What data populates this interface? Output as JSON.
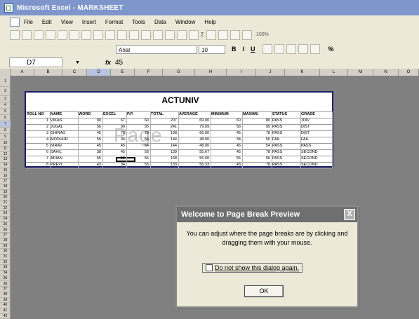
{
  "window": {
    "title": "Microsoft Excel - MARKSHEET"
  },
  "menu": [
    "File",
    "Edit",
    "View",
    "Insert",
    "Format",
    "Tools",
    "Data",
    "Window",
    "Help"
  ],
  "formatting": {
    "font": "Arial",
    "size": "10",
    "bold": "B",
    "italic": "I",
    "underline": "U",
    "percent": "%",
    "zoom": "100%"
  },
  "formula_bar": {
    "cell": "D7",
    "fx": "fx",
    "value": "45"
  },
  "columns": [
    "A",
    "B",
    "C",
    "D",
    "E",
    "F",
    "G",
    "H",
    "I",
    "J",
    "K",
    "L",
    "M",
    "N",
    "O"
  ],
  "rows": [
    "1",
    "2",
    "3",
    "4",
    "5",
    "6",
    "7",
    "8",
    "9",
    "10",
    "11",
    "12",
    "13",
    "14",
    "15",
    "16",
    "17",
    "18",
    "19",
    "20",
    "21",
    "22",
    "23",
    "24",
    "25",
    "26",
    "27",
    "28",
    "29",
    "30",
    "31",
    "32",
    "33",
    "34",
    "35",
    "36",
    "37",
    "38",
    "39",
    "40",
    "41",
    "42"
  ],
  "sheet": {
    "title": "ACTUNIV",
    "watermark": "Page",
    "headers": [
      "ROLL NO",
      "NAME",
      "WORD",
      "EXCEL",
      "P.P.",
      "TOTAL",
      "AVERAGE",
      "MINIMUM",
      "MAXIMU",
      "STATUS",
      "GRADE"
    ],
    "data": [
      [
        "1",
        "VIKAS",
        "80",
        "67",
        "60",
        "207",
        "69.00",
        "60",
        "80",
        "PASS",
        "1DIV"
      ],
      [
        "2",
        "JUGAL",
        "56",
        "90",
        "95",
        "241",
        "79.09",
        "56",
        "95",
        "PASS",
        "DIST"
      ],
      [
        "3",
        "CHIRAG",
        "45",
        "75",
        "78",
        "198",
        "66.00",
        "45",
        "78",
        "PASS",
        "DIST"
      ],
      [
        "4",
        "MODHUR",
        "56",
        "34",
        "54",
        "144",
        "48.00",
        "34",
        "56",
        "FAIL",
        "FAIL"
      ],
      [
        "5",
        "NIRAV",
        "45",
        "45",
        "54",
        "144",
        "48.00",
        "45",
        "54",
        "PASS",
        "PASS"
      ],
      [
        "6",
        "SAHIL",
        "38",
        "45",
        "56",
        "139",
        "55.67",
        "45",
        "78",
        "PASS",
        "SECOND"
      ],
      [
        "7",
        "ADIAN",
        "55",
        "55",
        "56",
        "168",
        "56.00",
        "55",
        "56",
        "PASS",
        "SECOND"
      ],
      [
        "8",
        "PREVI",
        "43",
        "34",
        "56",
        "133",
        "56.33",
        "43",
        "78",
        "PASS",
        "SECOND"
      ]
    ]
  },
  "dialog": {
    "title": "Welcome to Page Break Preview",
    "message": "You can adjust where the page breaks are by clicking and dragging them with your mouse.",
    "checkbox": "Do not show this dialog again.",
    "ok": "OK",
    "close": "X"
  }
}
